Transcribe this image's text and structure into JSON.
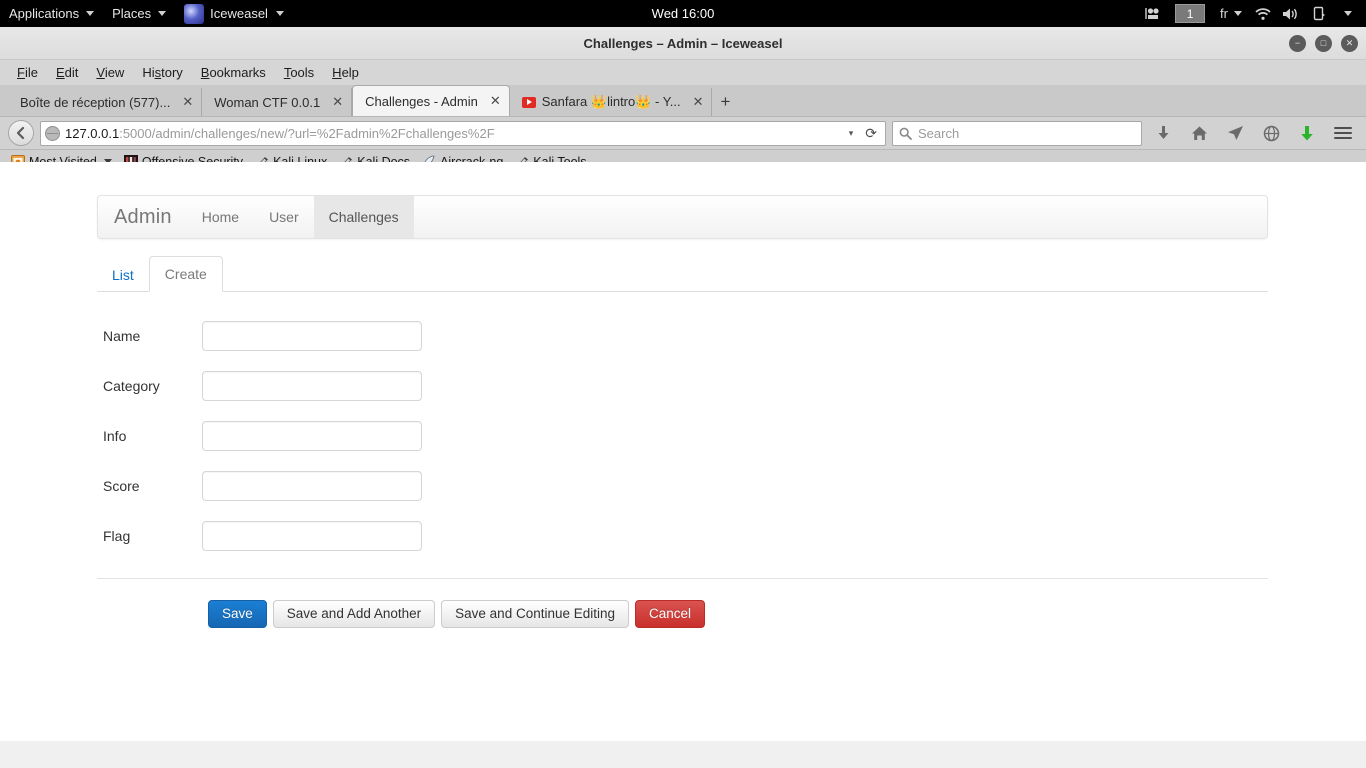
{
  "desktop": {
    "applications_label": "Applications",
    "places_label": "Places",
    "app_label": "Iceweasel",
    "clock": "Wed 16:00",
    "workspace": "1",
    "language": "fr",
    "tray": [
      "screencast-icon",
      "wifi-icon",
      "volume-icon",
      "battery-icon"
    ]
  },
  "window": {
    "title": "Challenges – Admin – Iceweasel",
    "minimize": "−",
    "maximize": "□",
    "close": "✕"
  },
  "menubar": [
    {
      "pre": "",
      "key": "F",
      "post": "ile"
    },
    {
      "pre": "",
      "key": "E",
      "post": "dit"
    },
    {
      "pre": "",
      "key": "V",
      "post": "iew"
    },
    {
      "pre": "Hi",
      "key": "s",
      "post": "tory"
    },
    {
      "pre": "",
      "key": "B",
      "post": "ookmarks"
    },
    {
      "pre": "",
      "key": "T",
      "post": "ools"
    },
    {
      "pre": "",
      "key": "H",
      "post": "elp"
    }
  ],
  "tabs": [
    {
      "label": "Boîte de réception (577)...",
      "active": false,
      "favicon": "none",
      "close": "✕"
    },
    {
      "label": "Woman CTF 0.0.1",
      "active": false,
      "favicon": "none",
      "close": "✕"
    },
    {
      "label": "Challenges - Admin",
      "active": true,
      "favicon": "none",
      "close": "✕"
    },
    {
      "label": "Sanfara 👑lintro👑 - Y...",
      "active": false,
      "favicon": "youtube-icon",
      "close": "✕"
    }
  ],
  "newtab_label": "+",
  "navbar": {
    "back_icon": "←",
    "url_host": "127.0.0.1",
    "url_rest": ":5000/admin/challenges/new/?url=%2Fadmin%2Fchallenges%2F",
    "url_dropdown": "▾",
    "reload_icon": "⟳",
    "search_placeholder": "Search",
    "icons": [
      "downloads-icon",
      "home-icon",
      "send-tab-icon",
      "globe-icon",
      "download-arrow-icon",
      "hamburger-menu-icon"
    ]
  },
  "bookmarks": [
    {
      "label": "Most Visited",
      "icon": "most-visited-icon",
      "caret": true
    },
    {
      "label": "Offensive Security",
      "icon": "offensive-security-icon",
      "caret": false
    },
    {
      "label": "Kali Linux",
      "icon": "kali-dragon-icon",
      "caret": false
    },
    {
      "label": "Kali Docs",
      "icon": "kali-dragon-icon",
      "caret": false
    },
    {
      "label": "Aircrack-ng",
      "icon": "aircrack-icon",
      "caret": false
    },
    {
      "label": "Kali Tools",
      "icon": "kali-dragon-icon",
      "caret": false
    }
  ],
  "admin": {
    "brand": "Admin",
    "nav": [
      {
        "label": "Home",
        "active": false
      },
      {
        "label": "User",
        "active": false
      },
      {
        "label": "Challenges",
        "active": true
      }
    ],
    "tabs": [
      {
        "label": "List",
        "active": false
      },
      {
        "label": "Create",
        "active": true
      }
    ],
    "form": {
      "fields": [
        {
          "label": "Name",
          "value": "",
          "placeholder": ""
        },
        {
          "label": "Category",
          "value": "",
          "placeholder": ""
        },
        {
          "label": "Info",
          "value": "",
          "placeholder": ""
        },
        {
          "label": "Score",
          "value": "",
          "placeholder": ""
        },
        {
          "label": "Flag",
          "value": "",
          "placeholder": ""
        }
      ],
      "buttons": [
        {
          "label": "Save",
          "style": "primary"
        },
        {
          "label": "Save and Add Another",
          "style": "default"
        },
        {
          "label": "Save and Continue Editing",
          "style": "default"
        },
        {
          "label": "Cancel",
          "style": "danger"
        }
      ]
    }
  },
  "colors": {
    "primary": "#1667b3",
    "danger": "#c9302c",
    "link": "#0f6fc5",
    "panel_bg": "#000000"
  }
}
